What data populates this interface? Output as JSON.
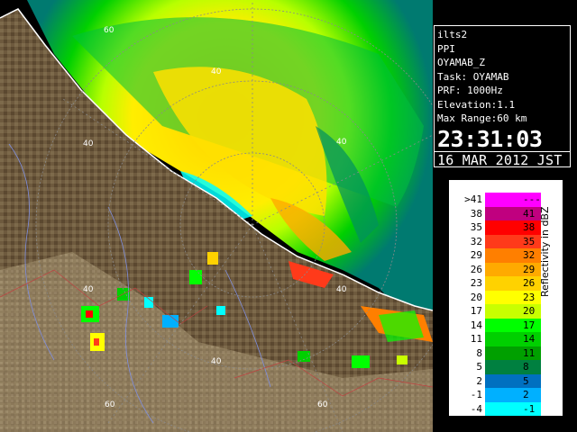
{
  "info": {
    "station": "ilts2",
    "scan_type": "PPI",
    "product": "OYAMAB_Z",
    "task": "Task: OYAMAB",
    "prf": "PRF: 1000Hz",
    "elevation": "Elevation:1.1",
    "max_range": "Max Range:60 km",
    "time": "23:31:03",
    "date": "16 MAR 2012 JST"
  },
  "legend": {
    "unit": "Reflectivity in dBZ",
    "rows": [
      {
        "lo": ">41",
        "hi": "---",
        "color": "#ff00ff"
      },
      {
        "lo": "38",
        "hi": "41",
        "color": "#c0007f"
      },
      {
        "lo": "35",
        "hi": "38",
        "color": "#ff0000"
      },
      {
        "lo": "32",
        "hi": "35",
        "color": "#ff3a1a"
      },
      {
        "lo": "29",
        "hi": "32",
        "color": "#ff7f00"
      },
      {
        "lo": "26",
        "hi": "29",
        "color": "#ffaa00"
      },
      {
        "lo": "23",
        "hi": "26",
        "color": "#ffd200"
      },
      {
        "lo": "20",
        "hi": "23",
        "color": "#ffff00"
      },
      {
        "lo": "17",
        "hi": "20",
        "color": "#c8ff00"
      },
      {
        "lo": "14",
        "hi": "17",
        "color": "#00ff00"
      },
      {
        "lo": "11",
        "hi": "14",
        "color": "#00d000"
      },
      {
        "lo": "8",
        "hi": "11",
        "color": "#00a000"
      },
      {
        "lo": "5",
        "hi": "8",
        "color": "#008040"
      },
      {
        "lo": "2",
        "hi": "5",
        "color": "#0070c0"
      },
      {
        "lo": "-1",
        "hi": "2",
        "color": "#00b0ff"
      },
      {
        "lo": "-4",
        "hi": "-1",
        "color": "#00ffff"
      }
    ]
  },
  "range_labels": [
    "60",
    "40",
    "40",
    "40",
    "40",
    "40",
    "60",
    "60",
    "40"
  ]
}
